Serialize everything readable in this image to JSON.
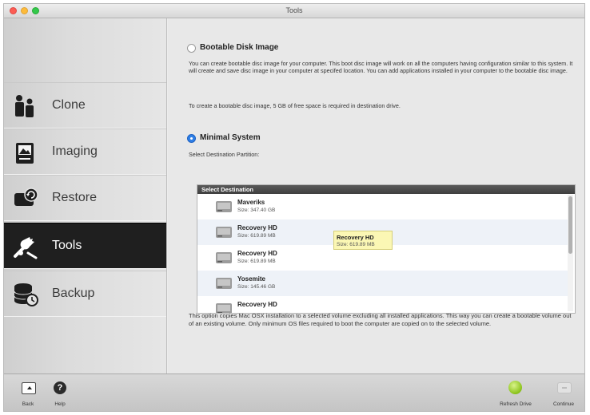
{
  "window": {
    "title": "Tools"
  },
  "sidebar": {
    "items": [
      {
        "label": "Clone",
        "icon": "clone-icon",
        "active": false
      },
      {
        "label": "Imaging",
        "icon": "imaging-icon",
        "active": false
      },
      {
        "label": "Restore",
        "icon": "restore-icon",
        "active": false
      },
      {
        "label": "Tools",
        "icon": "tools-icon",
        "active": true
      },
      {
        "label": "Backup",
        "icon": "backup-icon",
        "active": false
      }
    ]
  },
  "main": {
    "bootable": {
      "title": "Bootable Disk Image",
      "selected": false,
      "description": "You can create bootable disc image for your computer. This boot disc image will work on all the computers having configuration similar to this system.  It will create and save disc image in  your computer at specifed location. You can add applications installed in your computer to the bootable disc image.",
      "note": "To create a bootable disc image, 5 GB of free space is required in destination drive."
    },
    "minimal": {
      "title": "Minimal System",
      "selected": true,
      "dest_label": "Select Destination Partition:",
      "list_header": "Select Destination",
      "volumes": [
        {
          "name": "Maveriks",
          "size": "Size: 347.40 GB"
        },
        {
          "name": "Recovery HD",
          "size": "Size: 619.89 MB"
        },
        {
          "name": "Recovery HD",
          "size": "Size: 619.89 MB"
        },
        {
          "name": "Yosemite",
          "size": "Size: 145.46 GB"
        },
        {
          "name": "Recovery HD",
          "size": ""
        }
      ],
      "tooltip": {
        "name": "Recovery HD",
        "size": "Size: 619.89 MB"
      },
      "footer": "This option copies Mac OSX installation to a selected volume excluding all installed applications. This way you can create a bootable volume out  of an existing volume. Only minimum OS files required to boot the computer are copied on to the selected volume."
    }
  },
  "bottombar": {
    "back": "Back",
    "help": "Help",
    "refresh": "Refresh Drive",
    "continue": "Continue"
  },
  "colors": {
    "accent": "#2f7fe6",
    "active_nav": "#1f1f1f",
    "tooltip_bg": "#fbf7b4",
    "refresh_green": "#8ac21a"
  }
}
